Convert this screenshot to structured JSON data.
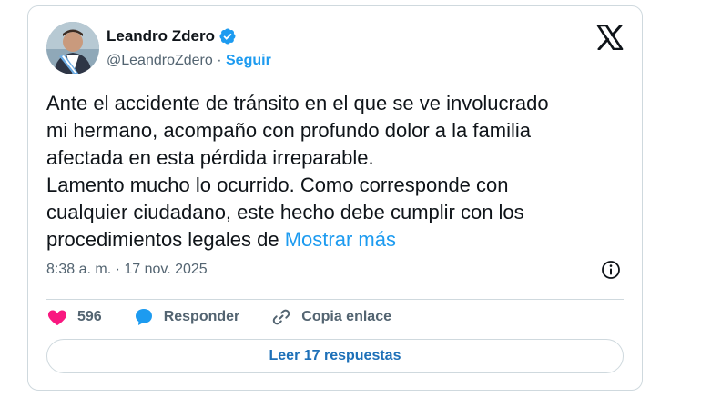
{
  "author": {
    "name": "Leandro Zdero",
    "handle": "@LeandroZdero",
    "separator": "·",
    "follow_label": "Seguir"
  },
  "tweet": {
    "lines": [
      "Ante el accidente de tránsito en el que se ve involucrado",
      "mi hermano, acompaño con profundo dolor a la familia",
      "afectada en esta pérdida irreparable.",
      "Lamento mucho lo ocurrido. Como corresponde con",
      "cualquier ciudadano, este hecho debe cumplir con los",
      "procedimientos legales de"
    ],
    "show_more_label": "Mostrar más",
    "timestamp": "8:38 a. m. · 17 nov. 2025"
  },
  "actions": {
    "like_count": "596",
    "reply_label": "Responder",
    "copy_link_label": "Copia enlace"
  },
  "read_replies_label": "Leer 17 respuestas",
  "icons": {
    "verified": "verified-badge-icon",
    "brand": "x-logo-icon",
    "info": "info-icon",
    "like": "heart-icon",
    "reply": "speech-bubble-icon",
    "copy": "link-icon"
  },
  "colors": {
    "accent": "#1d9bf0",
    "like": "#f91880",
    "text": "#0f1419",
    "muted": "#536471",
    "border": "#cfd9de"
  }
}
